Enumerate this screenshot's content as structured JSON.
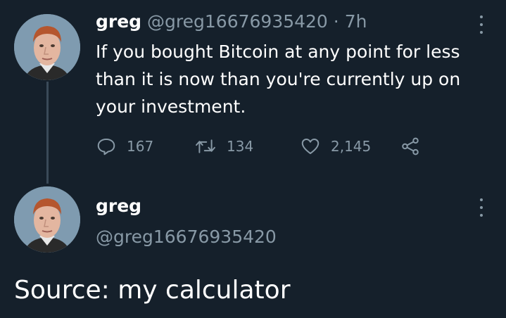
{
  "tweet1": {
    "name": "greg",
    "handle": "@greg16676935420",
    "separator": " · ",
    "time": "7h",
    "text": "If you bought Bitcoin at any point for less than it is now than you're currently up on your investment.",
    "replies": "167",
    "retweets": "134",
    "likes": "2,145",
    "avatar_icon": "profile-photo-icon"
  },
  "tweet2": {
    "name": "greg",
    "handle": "@greg16676935420",
    "text": "Source: my calculator",
    "avatar_icon": "profile-photo-icon"
  },
  "icons": {
    "reply": "reply-icon",
    "retweet": "retweet-icon",
    "like": "heart-icon",
    "share": "share-icon",
    "more": "more-options-icon"
  },
  "colors": {
    "background": "#15202b",
    "text": "#ffffff",
    "muted": "#8899a6",
    "thread_line": "#3a4a58"
  }
}
